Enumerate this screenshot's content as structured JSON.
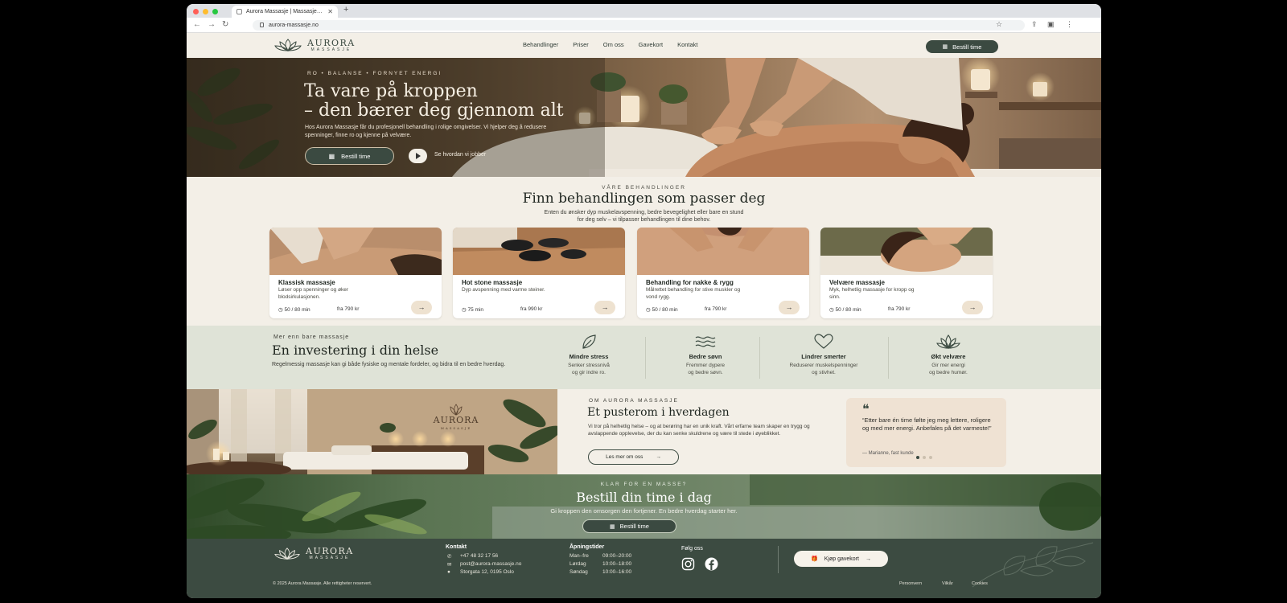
{
  "browser": {
    "tab_title": "Aurora Massasje | Massasje…",
    "url": "aurora-massasje.no"
  },
  "colors": {
    "brand_green": "#3b4a41",
    "cream": "#f3efe7",
    "sand": "#efe2d3",
    "sage": "#dfe3d7"
  },
  "site": {
    "logo_name": "AURORA",
    "logo_sub": "MASSASJE",
    "nav": [
      "Behandlinger",
      "Priser",
      "Om oss",
      "Gavekort",
      "Kontakt"
    ],
    "book_label": "Bestill time"
  },
  "hero": {
    "eyebrow": "RO  •  BALANSE  •  FORNYET ENERGI",
    "title_line1": "Ta vare på kroppen",
    "title_line2": "– den bærer deg gjennom alt",
    "text": "Hos Aurora Massasje får du profesjonell behandling i rolige omgivelser. Vi hjelper deg å redusere spenninger, finne ro og kjenne på velvære.",
    "book_label": "Bestill time",
    "video_label": "Se hvordan vi jobber"
  },
  "treatments": {
    "eyebrow": "VÅRE BEHANDLINGER",
    "title": "Finn behandlingen som passer deg",
    "subtitle_line1": "Enten du ønsker dyp muskelavspenning, bedre bevegelighet eller bare en stund",
    "subtitle_line2": "for deg selv – vi tilpasser behandlingen til dine behov.",
    "cards": [
      {
        "title": "Klassisk massasje",
        "desc": "Løser opp spenninger og øker blodsirkulasjonen.",
        "minutes": "50 / 80 min",
        "price": "fra 790 kr"
      },
      {
        "title": "Hot stone massasje",
        "desc": "Dyp avspenning med varme steiner.",
        "minutes": "75 min",
        "price": "fra 990 kr"
      },
      {
        "title": "Behandling for nakke & rygg",
        "desc": "Målrettet behandling for stive muskler og vond rygg.",
        "minutes": "50 / 80 min",
        "price": "fra 790 kr"
      },
      {
        "title": "Velvære massasje",
        "desc": "Myk, helhetlig massasje for kropp og sinn.",
        "minutes": "50 / 80 min",
        "price": "fra 790 kr"
      }
    ]
  },
  "benefits": {
    "eyebrow": "Mer enn bare massasje",
    "title": "En investering i din helse",
    "text": "Regelmessig massasje kan gi både fysiske og mentale fordeler, og bidra til en bedre hverdag.",
    "items": [
      {
        "icon": "leaf-icon",
        "title": "Mindre stress",
        "line1": "Senker stressnivå",
        "line2": "og gir indre ro."
      },
      {
        "icon": "waves-icon",
        "title": "Bedre søvn",
        "line1": "Fremmer dypere",
        "line2": "og bedre søvn."
      },
      {
        "icon": "heart-icon",
        "title": "Lindrer smerter",
        "line1": "Reduserer muskelspenninger",
        "line2": "og stivhet."
      },
      {
        "icon": "lotus-icon",
        "title": "Økt velvære",
        "line1": "Gir mer energi",
        "line2": "og bedre humør."
      }
    ]
  },
  "about": {
    "eyebrow": "OM AURORA MASSASJE",
    "title": "Et pusterom i hverdagen",
    "text": "Vi tror på helhetlig helse – og at berøring har en unik kraft. Vårt erfarne team skaper en trygg og avslappende opplevelse, der du kan senke skuldrene og være til stede i øyeblikket.",
    "button": "Les mer om oss",
    "quote": "“Etter bare én time følte jeg meg lettere, roligere og med mer energi. Anbefales på det varmeste!”",
    "quote_author": "— Marianne, fast kunde"
  },
  "cta": {
    "eyebrow": "KLAR FOR EN MASSE?",
    "title": "Bestill din time i dag",
    "text": "Gi kroppen den omsorgen den fortjener. En bedre hverdag starter her.",
    "button": "Bestill time"
  },
  "footer": {
    "contact_heading": "Kontakt",
    "phone": "+47 48 32 17 56",
    "email": "post@aurora-massasje.no",
    "address": "Storgata 12, 0195 Oslo",
    "hours_heading": "Åpningstider",
    "hours": [
      {
        "day": "Man–fre",
        "time": "09:00–20:00"
      },
      {
        "day": "Lørdag",
        "time": "10:00–18:00"
      },
      {
        "day": "Søndag",
        "time": "10:00–16:00"
      }
    ],
    "follow_heading": "Følg oss",
    "gift_button": "Kjøp gavekort",
    "copyright": "© 2025 Aurora Massasje. Alle rettigheter reservert.",
    "links": [
      "Personvern",
      "Vilkår",
      "Cookies"
    ]
  }
}
